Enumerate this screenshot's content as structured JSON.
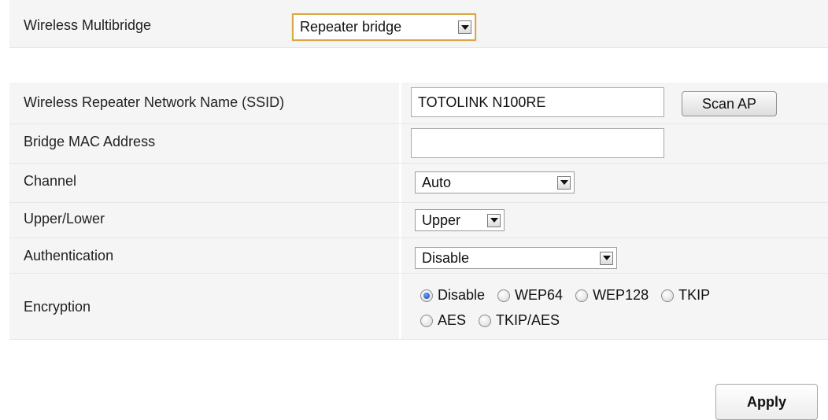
{
  "multibridge": {
    "label": "Wireless Multibridge",
    "value": "Repeater bridge"
  },
  "ssid": {
    "label": "Wireless Repeater Network Name (SSID)",
    "value": "TOTOLINK N100RE",
    "scan_button": "Scan AP"
  },
  "bridge_mac": {
    "label": "Bridge MAC Address",
    "value": ""
  },
  "channel": {
    "label": "Channel",
    "value": "Auto"
  },
  "upper_lower": {
    "label": "Upper/Lower",
    "value": "Upper"
  },
  "authentication": {
    "label": "Authentication",
    "value": "Disable"
  },
  "encryption": {
    "label": "Encryption",
    "options": [
      "Disable",
      "WEP64",
      "WEP128",
      "TKIP",
      "AES",
      "TKIP/AES"
    ],
    "selected": "Disable"
  },
  "apply_button": "Apply",
  "colors": {
    "row_bg": "#f5f5f5",
    "focus_border": "#d9a64a",
    "radio_selected": "#1842a8"
  }
}
